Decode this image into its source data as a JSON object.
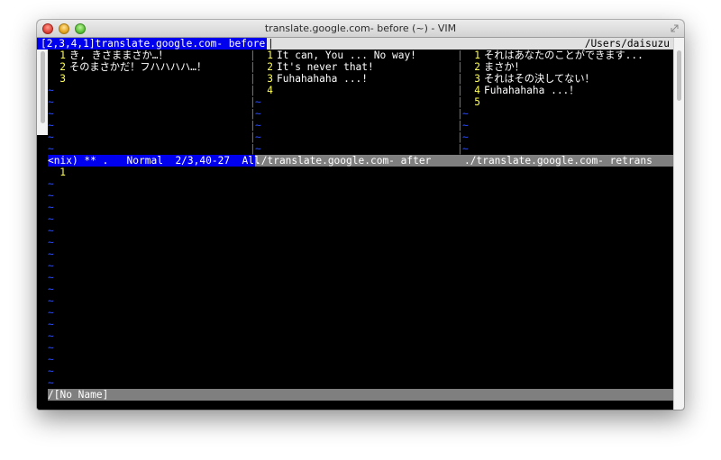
{
  "window": {
    "title": "translate.google.com- before (~) - VIM"
  },
  "tabline": {
    "selected_tab": "[2,3,4,1]translate.google.com- before",
    "separator": "|",
    "cwd": "/Users/daisuzu"
  },
  "panes": [
    {
      "lines": [
        {
          "num": "1",
          "text": "き, きさままさか…！"
        },
        {
          "num": "2",
          "text": "そのまさかだ！フハハハハ…！"
        },
        {
          "num": "3",
          "text": ""
        }
      ]
    },
    {
      "lines": [
        {
          "num": "1",
          "text": "It can, You ... No way!"
        },
        {
          "num": "2",
          "text": "It's never that!"
        },
        {
          "num": "3",
          "text": "Fuhahahaha ...!"
        },
        {
          "num": "4",
          "text": ""
        }
      ]
    },
    {
      "lines": [
        {
          "num": "1",
          "text": "それはあなたのことができます..."
        },
        {
          "num": "2",
          "text": "まさか！"
        },
        {
          "num": "3",
          "text": "それはその決してない！"
        },
        {
          "num": "4",
          "text": "Fuhahahaha ...！"
        },
        {
          "num": "5",
          "text": ""
        }
      ]
    }
  ],
  "status_top": {
    "current": "<nix) ** .   Normal  2/3,40-27  All",
    "middle": "./translate.google.com- after",
    "right": "./translate.google.com- retrans"
  },
  "bottom_pane": {
    "lines": [
      {
        "num": "1",
        "text": ""
      }
    ]
  },
  "status_bottom": {
    "text": "/[No Name]"
  },
  "tilde": "~",
  "colors": {
    "background": "#000000",
    "line_number": "#ffff55",
    "tilde": "#2c4fff",
    "active_tab": "#0000ee",
    "statusline": "#7f7f7f"
  }
}
